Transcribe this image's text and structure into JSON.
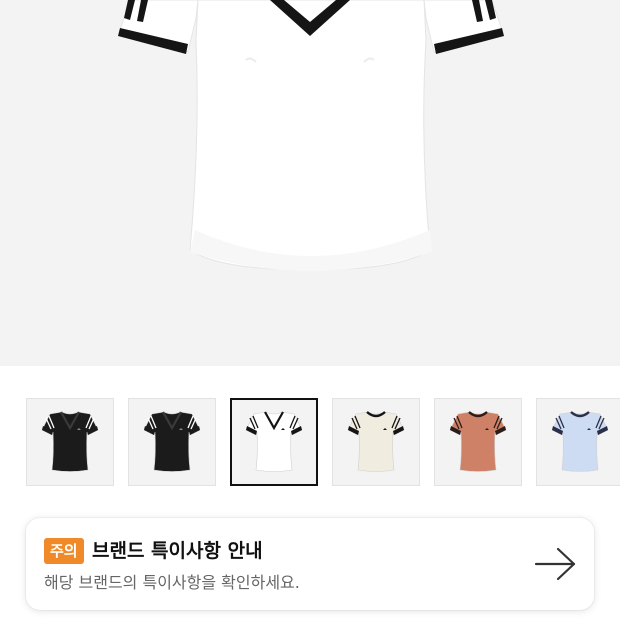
{
  "product_image": {
    "icon": "white-v-neck-tshirt-image"
  },
  "thumbnails": [
    {
      "icon": "black-v-neck-tshirt-thumb",
      "body_color": "#1b1b1b",
      "trim_color": "#1b1b1b",
      "stripe_color": "#ffffff",
      "neck": "v",
      "selected": false
    },
    {
      "icon": "black-v-neck-tshirt-thumb",
      "body_color": "#1b1b1b",
      "trim_color": "#1b1b1b",
      "stripe_color": "#ffffff",
      "neck": "v",
      "selected": false
    },
    {
      "icon": "white-v-neck-tshirt-thumb",
      "body_color": "#ffffff",
      "trim_color": "#151515",
      "stripe_color": "#ffffff",
      "neck": "v",
      "selected": true
    },
    {
      "icon": "cream-crew-tshirt-thumb",
      "body_color": "#f1ece0",
      "trim_color": "#151515",
      "stripe_color": "#f1ece0",
      "neck": "crew",
      "selected": false
    },
    {
      "icon": "salmon-crew-tshirt-thumb",
      "body_color": "#cf8168",
      "trim_color": "#2a1c18",
      "stripe_color": "#cf8168",
      "neck": "crew",
      "selected": false
    },
    {
      "icon": "light-blue-crew-tshirt-thumb",
      "body_color": "#cddcf2",
      "trim_color": "#2b2f4a",
      "stripe_color": "#cddcf2",
      "neck": "crew",
      "selected": false
    }
  ],
  "notice": {
    "badge": "주의",
    "title": "브랜드 특이사항 안내",
    "subtitle": "해당 브랜드의 특이사항을 확인하세요.",
    "arrow_icon": "arrow-right-icon",
    "badge_color": "#f08a28"
  }
}
